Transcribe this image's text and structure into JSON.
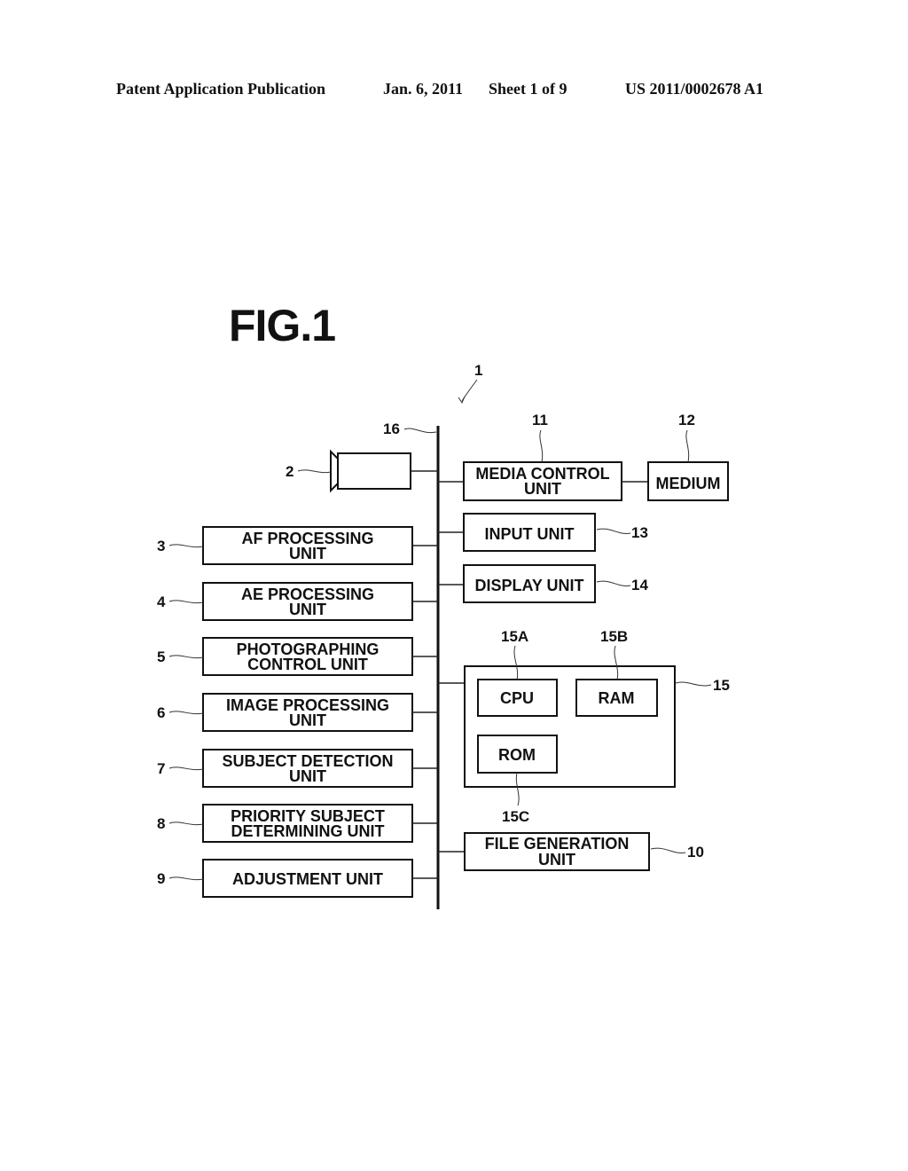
{
  "header": {
    "publication_type": "Patent Application Publication",
    "date": "Jan. 6, 2011",
    "sheet": "Sheet 1 of 9",
    "publication_number": "US 2011/0002678 A1"
  },
  "figure": {
    "title": "FIG.1",
    "device_ref": "1",
    "bus_ref": "16",
    "camera_ref": "2",
    "left_units": [
      {
        "ref": "3",
        "lines": [
          "AF PROCESSING",
          "UNIT"
        ]
      },
      {
        "ref": "4",
        "lines": [
          "AE PROCESSING",
          "UNIT"
        ]
      },
      {
        "ref": "5",
        "lines": [
          "PHOTOGRAPHING",
          "CONTROL UNIT"
        ]
      },
      {
        "ref": "6",
        "lines": [
          "IMAGE PROCESSING",
          "UNIT"
        ]
      },
      {
        "ref": "7",
        "lines": [
          "SUBJECT DETECTION",
          "UNIT"
        ]
      },
      {
        "ref": "8",
        "lines": [
          "PRIORITY SUBJECT",
          "DETERMINING UNIT"
        ]
      },
      {
        "ref": "9",
        "lines": [
          "ADJUSTMENT UNIT"
        ]
      }
    ],
    "media_control": {
      "ref": "11",
      "lines": [
        "MEDIA CONTROL",
        "UNIT"
      ]
    },
    "medium": {
      "ref": "12",
      "label": "MEDIUM"
    },
    "input_unit": {
      "ref": "13",
      "label": "INPUT UNIT"
    },
    "display_unit": {
      "ref": "14",
      "label": "DISPLAY UNIT"
    },
    "control_block": {
      "ref": "15",
      "cpu": {
        "ref": "15A",
        "label": "CPU"
      },
      "ram": {
        "ref": "15B",
        "label": "RAM"
      },
      "rom": {
        "ref": "15C",
        "label": "ROM"
      }
    },
    "file_generation": {
      "ref": "10",
      "lines": [
        "FILE GENERATION",
        "UNIT"
      ]
    }
  }
}
